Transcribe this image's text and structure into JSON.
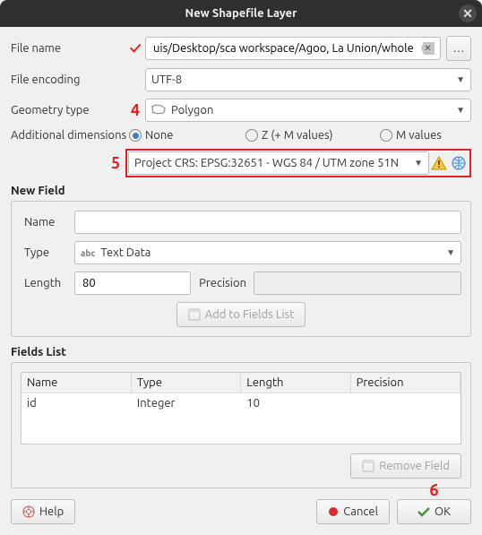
{
  "window": {
    "title": "New Shapefile Layer"
  },
  "annotations": {
    "check": "✓",
    "a4": "4",
    "a5": "5",
    "a6": "6"
  },
  "labels": {
    "file_name": "File name",
    "file_encoding": "File encoding",
    "geometry_type": "Geometry type",
    "additional_dimensions": "Additional dimensions",
    "new_field": "New Field",
    "name": "Name",
    "type": "Type",
    "length": "Length",
    "precision": "Precision",
    "fields_list": "Fields List"
  },
  "file_name": {
    "value": "uis/Desktop/sca workspace/Agoo, La Union/whole area.shp",
    "browse": "…"
  },
  "file_encoding": {
    "value": "UTF-8"
  },
  "geometry_type": {
    "value": "Polygon"
  },
  "dimensions": {
    "none": "None",
    "z": "Z (+ M values)",
    "m": "M values",
    "selected": "none"
  },
  "crs": {
    "value": "Project CRS: EPSG:32651 - WGS 84 / UTM zone 51N"
  },
  "new_field": {
    "name": "",
    "type": "Text Data",
    "type_prefix": "abc",
    "length": "80",
    "precision": ""
  },
  "buttons": {
    "add_to_fields": "Add to Fields List",
    "remove_field": "Remove Field",
    "help": "Help",
    "cancel": "Cancel",
    "ok": "OK"
  },
  "fields_table": {
    "headers": [
      "Name",
      "Type",
      "Length",
      "Precision"
    ],
    "rows": [
      {
        "name": "id",
        "type": "Integer",
        "length": "10",
        "precision": ""
      }
    ]
  }
}
